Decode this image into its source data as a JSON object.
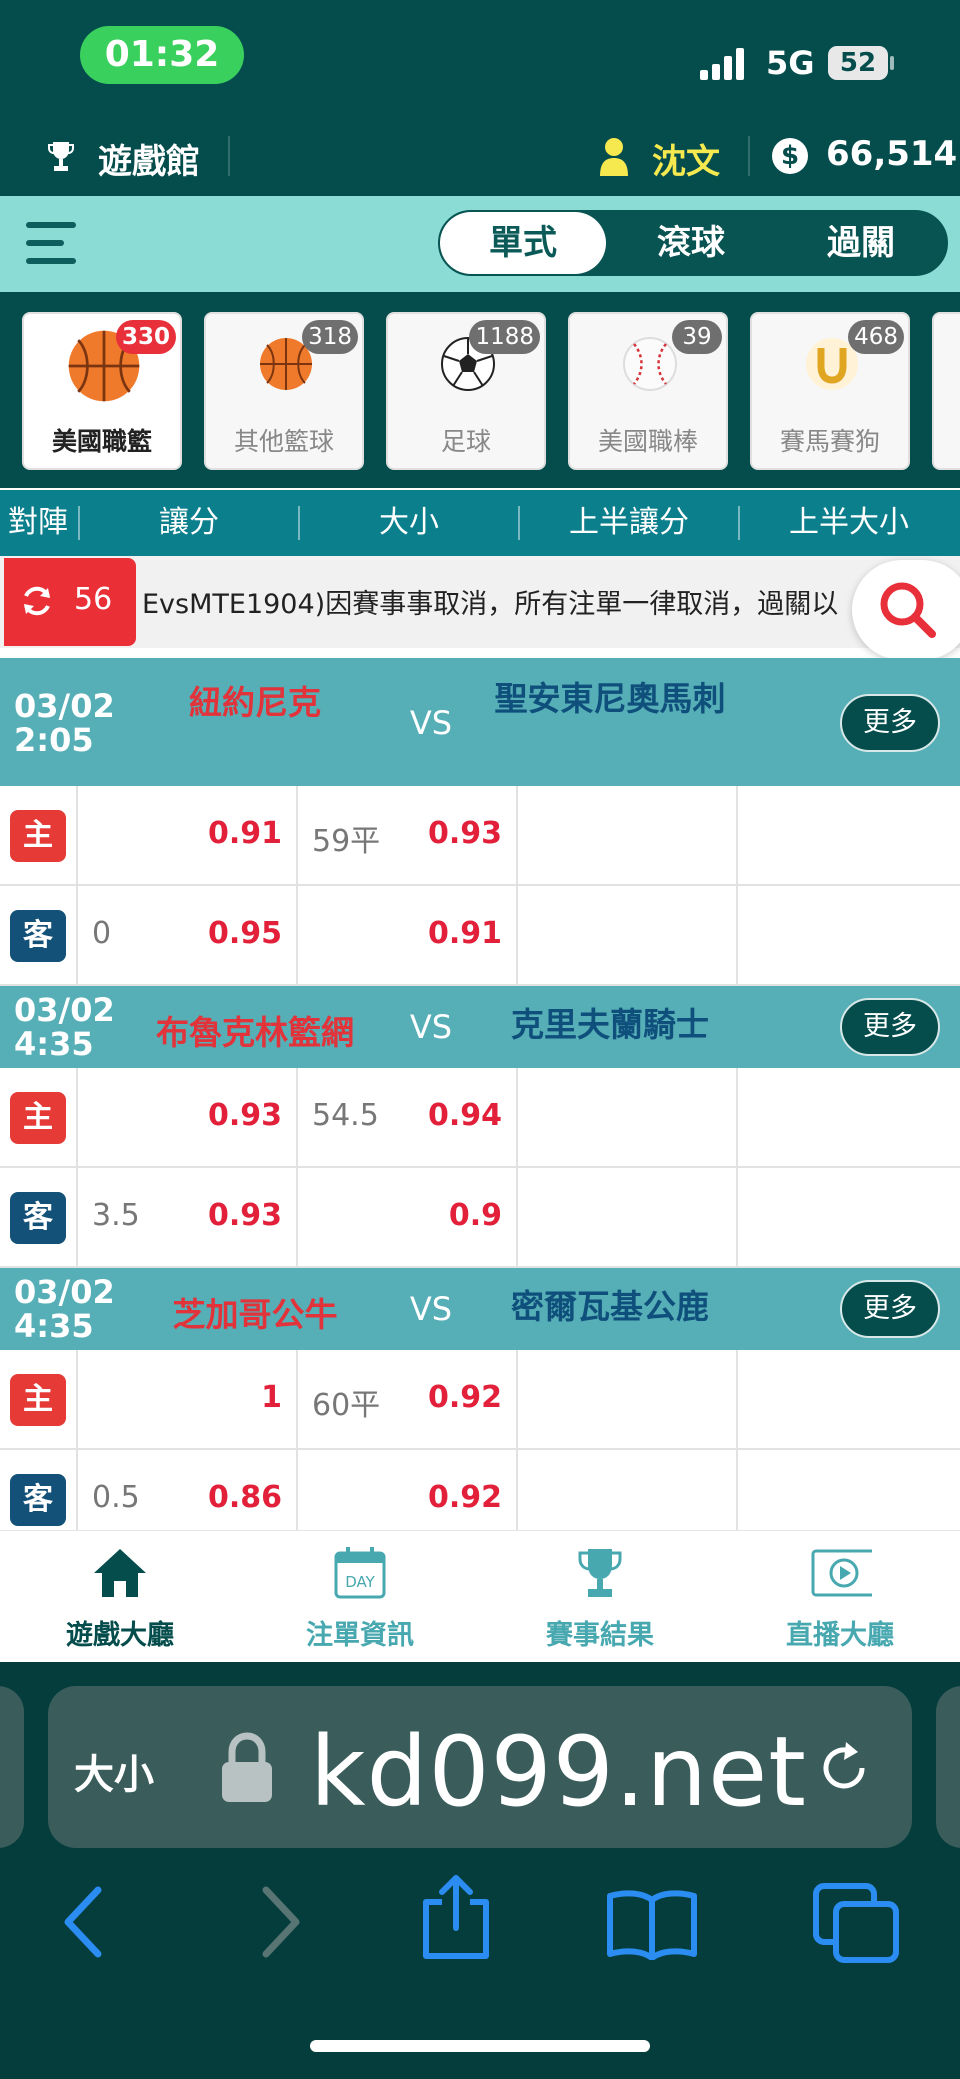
{
  "status_bar": {
    "time": "01:32",
    "network": "5G",
    "battery": "52"
  },
  "header": {
    "title": "遊戲館",
    "username": "沈文",
    "balance": "66,514"
  },
  "modes": {
    "tabs": [
      "單式",
      "滾球",
      "過關"
    ],
    "active": "單式"
  },
  "sports": [
    {
      "label": "美國職籃",
      "count": "330",
      "icon": "basketball-icon",
      "active": true
    },
    {
      "label": "其他籃球",
      "count": "318",
      "icon": "basketball-icon",
      "active": false
    },
    {
      "label": "足球",
      "count": "1188",
      "icon": "soccer-ball-icon",
      "active": false
    },
    {
      "label": "美國職棒",
      "count": "39",
      "icon": "baseball-icon",
      "active": false
    },
    {
      "label": "賽馬賽狗",
      "count": "468",
      "icon": "horseshoe-icon",
      "active": false
    }
  ],
  "columns": [
    "對陣",
    "讓分",
    "大小",
    "上半讓分",
    "上半大小"
  ],
  "notice": {
    "refresh_count": "56",
    "text": "EvsMTE1904)因賽事事取消，所有注單一律取消，過關以"
  },
  "labels": {
    "home": "主",
    "away": "客",
    "vs": "VS",
    "more": "更多"
  },
  "matches": [
    {
      "date": "03/02",
      "time": "2:05",
      "home_team": "紐約尼克",
      "away_team": "聖安東尼奧馬刺",
      "home_row": {
        "spread_line": "",
        "spread_odds": "0.91",
        "total_line": "59平",
        "total_odds": "0.93"
      },
      "away_row": {
        "spread_line": "0",
        "spread_odds": "0.95",
        "total_line": "",
        "total_odds": "0.91"
      }
    },
    {
      "date": "03/02",
      "time": "4:35",
      "home_team": "布魯克林籃網",
      "away_team": "克里夫蘭騎士",
      "home_row": {
        "spread_line": "",
        "spread_odds": "0.93",
        "total_line": "54.5",
        "total_odds": "0.94"
      },
      "away_row": {
        "spread_line": "3.5",
        "spread_odds": "0.93",
        "total_line": "",
        "total_odds": "0.9"
      }
    },
    {
      "date": "03/02",
      "time": "4:35",
      "home_team": "芝加哥公牛",
      "away_team": "密爾瓦基公鹿",
      "home_row": {
        "spread_line": "",
        "spread_odds": "1",
        "total_line": "60平",
        "total_odds": "0.92"
      },
      "away_row": {
        "spread_line": "0.5",
        "spread_odds": "0.86",
        "total_line": "",
        "total_odds": "0.92"
      }
    }
  ],
  "bottom_nav": [
    {
      "label": "遊戲大廳",
      "icon": "home-icon",
      "active": true
    },
    {
      "label": "注單資訊",
      "icon": "calendar-day-icon",
      "active": false
    },
    {
      "label": "賽事結果",
      "icon": "trophy-icon",
      "active": false
    },
    {
      "label": "直播大廳",
      "icon": "live-play-icon",
      "active": false
    }
  ],
  "browser": {
    "text_size": "大小",
    "url": "kd099.net"
  },
  "icon_glyphs": {
    "calendar_day": "DAY"
  },
  "colors": {
    "dark_teal": "#044d4c",
    "mint": "#8cdcd6",
    "header_blue": "#0c7f8c",
    "match_header": "#56aeb6",
    "odds_red": "#e2203a",
    "home_team_red": "#e2333a",
    "away_team_blue": "#0f4f7c",
    "username_yellow": "#f6e94f"
  }
}
